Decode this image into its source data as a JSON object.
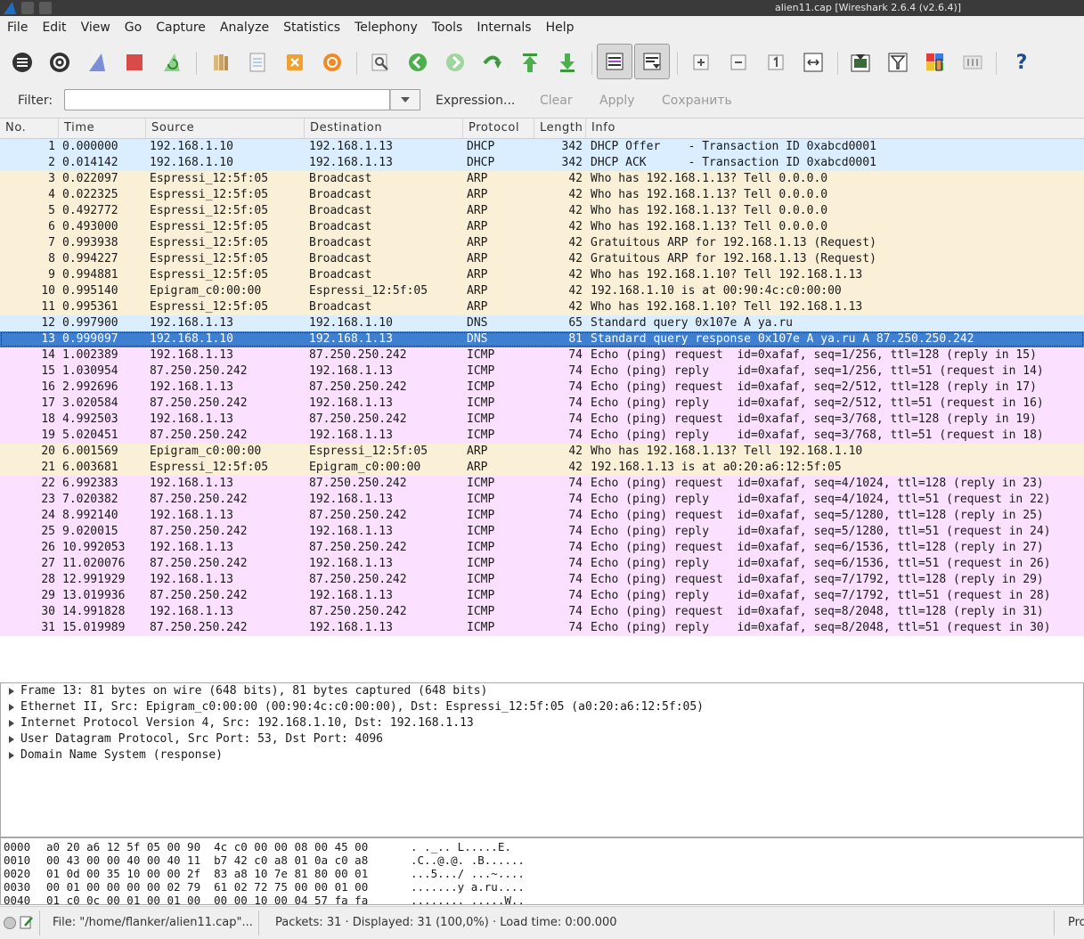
{
  "window": {
    "title": "alien11.cap [Wireshark 2.6.4 (v2.6.4)]"
  },
  "menu": [
    "File",
    "Edit",
    "View",
    "Go",
    "Capture",
    "Analyze",
    "Statistics",
    "Telephony",
    "Tools",
    "Internals",
    "Help"
  ],
  "filter": {
    "label": "Filter:",
    "value": "",
    "expression_label": "Expression...",
    "clear_label": "Clear",
    "apply_label": "Apply",
    "save_label": "Сохранить"
  },
  "packet_list": {
    "columns": [
      "No.",
      "Time",
      "Source",
      "Destination",
      "Protocol",
      "Length",
      "Info"
    ],
    "selected_no": "13",
    "rows": [
      {
        "no": "1",
        "time": "0.000000",
        "src": "192.168.1.10",
        "dst": "192.168.1.13",
        "proto": "DHCP",
        "len": "342",
        "info": "DHCP Offer    - Transaction ID 0xabcd0001",
        "cls": "dhcp"
      },
      {
        "no": "2",
        "time": "0.014142",
        "src": "192.168.1.10",
        "dst": "192.168.1.13",
        "proto": "DHCP",
        "len": "342",
        "info": "DHCP ACK      - Transaction ID 0xabcd0001",
        "cls": "dhcp"
      },
      {
        "no": "3",
        "time": "0.022097",
        "src": "Espressi_12:5f:05",
        "dst": "Broadcast",
        "proto": "ARP",
        "len": "42",
        "info": "Who has 192.168.1.13? Tell 0.0.0.0",
        "cls": "arp"
      },
      {
        "no": "4",
        "time": "0.022325",
        "src": "Espressi_12:5f:05",
        "dst": "Broadcast",
        "proto": "ARP",
        "len": "42",
        "info": "Who has 192.168.1.13? Tell 0.0.0.0",
        "cls": "arp"
      },
      {
        "no": "5",
        "time": "0.492772",
        "src": "Espressi_12:5f:05",
        "dst": "Broadcast",
        "proto": "ARP",
        "len": "42",
        "info": "Who has 192.168.1.13? Tell 0.0.0.0",
        "cls": "arp"
      },
      {
        "no": "6",
        "time": "0.493000",
        "src": "Espressi_12:5f:05",
        "dst": "Broadcast",
        "proto": "ARP",
        "len": "42",
        "info": "Who has 192.168.1.13? Tell 0.0.0.0",
        "cls": "arp"
      },
      {
        "no": "7",
        "time": "0.993938",
        "src": "Espressi_12:5f:05",
        "dst": "Broadcast",
        "proto": "ARP",
        "len": "42",
        "info": "Gratuitous ARP for 192.168.1.13 (Request)",
        "cls": "arp"
      },
      {
        "no": "8",
        "time": "0.994227",
        "src": "Espressi_12:5f:05",
        "dst": "Broadcast",
        "proto": "ARP",
        "len": "42",
        "info": "Gratuitous ARP for 192.168.1.13 (Request)",
        "cls": "arp"
      },
      {
        "no": "9",
        "time": "0.994881",
        "src": "Espressi_12:5f:05",
        "dst": "Broadcast",
        "proto": "ARP",
        "len": "42",
        "info": "Who has 192.168.1.10? Tell 192.168.1.13",
        "cls": "arp"
      },
      {
        "no": "10",
        "time": "0.995140",
        "src": "Epigram_c0:00:00",
        "dst": "Espressi_12:5f:05",
        "proto": "ARP",
        "len": "42",
        "info": "192.168.1.10 is at 00:90:4c:c0:00:00",
        "cls": "arp"
      },
      {
        "no": "11",
        "time": "0.995361",
        "src": "Espressi_12:5f:05",
        "dst": "Broadcast",
        "proto": "ARP",
        "len": "42",
        "info": "Who has 192.168.1.10? Tell 192.168.1.13",
        "cls": "arp"
      },
      {
        "no": "12",
        "time": "0.997900",
        "src": "192.168.1.13",
        "dst": "192.168.1.10",
        "proto": "DNS",
        "len": "65",
        "info": "Standard query 0x107e A ya.ru",
        "cls": "dns"
      },
      {
        "no": "13",
        "time": "0.999097",
        "src": "192.168.1.10",
        "dst": "192.168.1.13",
        "proto": "DNS",
        "len": "81",
        "info": "Standard query response 0x107e A ya.ru A 87.250.250.242",
        "cls": "sel"
      },
      {
        "no": "14",
        "time": "1.002389",
        "src": "192.168.1.13",
        "dst": "87.250.250.242",
        "proto": "ICMP",
        "len": "74",
        "info": "Echo (ping) request  id=0xafaf, seq=1/256, ttl=128 (reply in 15)",
        "cls": "icmp"
      },
      {
        "no": "15",
        "time": "1.030954",
        "src": "87.250.250.242",
        "dst": "192.168.1.13",
        "proto": "ICMP",
        "len": "74",
        "info": "Echo (ping) reply    id=0xafaf, seq=1/256, ttl=51 (request in 14)",
        "cls": "icmp"
      },
      {
        "no": "16",
        "time": "2.992696",
        "src": "192.168.1.13",
        "dst": "87.250.250.242",
        "proto": "ICMP",
        "len": "74",
        "info": "Echo (ping) request  id=0xafaf, seq=2/512, ttl=128 (reply in 17)",
        "cls": "icmp"
      },
      {
        "no": "17",
        "time": "3.020584",
        "src": "87.250.250.242",
        "dst": "192.168.1.13",
        "proto": "ICMP",
        "len": "74",
        "info": "Echo (ping) reply    id=0xafaf, seq=2/512, ttl=51 (request in 16)",
        "cls": "icmp"
      },
      {
        "no": "18",
        "time": "4.992503",
        "src": "192.168.1.13",
        "dst": "87.250.250.242",
        "proto": "ICMP",
        "len": "74",
        "info": "Echo (ping) request  id=0xafaf, seq=3/768, ttl=128 (reply in 19)",
        "cls": "icmp"
      },
      {
        "no": "19",
        "time": "5.020451",
        "src": "87.250.250.242",
        "dst": "192.168.1.13",
        "proto": "ICMP",
        "len": "74",
        "info": "Echo (ping) reply    id=0xafaf, seq=3/768, ttl=51 (request in 18)",
        "cls": "icmp"
      },
      {
        "no": "20",
        "time": "6.001569",
        "src": "Epigram_c0:00:00",
        "dst": "Espressi_12:5f:05",
        "proto": "ARP",
        "len": "42",
        "info": "Who has 192.168.1.13? Tell 192.168.1.10",
        "cls": "arp"
      },
      {
        "no": "21",
        "time": "6.003681",
        "src": "Espressi_12:5f:05",
        "dst": "Epigram_c0:00:00",
        "proto": "ARP",
        "len": "42",
        "info": "192.168.1.13 is at a0:20:a6:12:5f:05",
        "cls": "arp"
      },
      {
        "no": "22",
        "time": "6.992383",
        "src": "192.168.1.13",
        "dst": "87.250.250.242",
        "proto": "ICMP",
        "len": "74",
        "info": "Echo (ping) request  id=0xafaf, seq=4/1024, ttl=128 (reply in 23)",
        "cls": "icmp"
      },
      {
        "no": "23",
        "time": "7.020382",
        "src": "87.250.250.242",
        "dst": "192.168.1.13",
        "proto": "ICMP",
        "len": "74",
        "info": "Echo (ping) reply    id=0xafaf, seq=4/1024, ttl=51 (request in 22)",
        "cls": "icmp"
      },
      {
        "no": "24",
        "time": "8.992140",
        "src": "192.168.1.13",
        "dst": "87.250.250.242",
        "proto": "ICMP",
        "len": "74",
        "info": "Echo (ping) request  id=0xafaf, seq=5/1280, ttl=128 (reply in 25)",
        "cls": "icmp"
      },
      {
        "no": "25",
        "time": "9.020015",
        "src": "87.250.250.242",
        "dst": "192.168.1.13",
        "proto": "ICMP",
        "len": "74",
        "info": "Echo (ping) reply    id=0xafaf, seq=5/1280, ttl=51 (request in 24)",
        "cls": "icmp"
      },
      {
        "no": "26",
        "time": "10.992053",
        "src": "192.168.1.13",
        "dst": "87.250.250.242",
        "proto": "ICMP",
        "len": "74",
        "info": "Echo (ping) request  id=0xafaf, seq=6/1536, ttl=128 (reply in 27)",
        "cls": "icmp"
      },
      {
        "no": "27",
        "time": "11.020076",
        "src": "87.250.250.242",
        "dst": "192.168.1.13",
        "proto": "ICMP",
        "len": "74",
        "info": "Echo (ping) reply    id=0xafaf, seq=6/1536, ttl=51 (request in 26)",
        "cls": "icmp"
      },
      {
        "no": "28",
        "time": "12.991929",
        "src": "192.168.1.13",
        "dst": "87.250.250.242",
        "proto": "ICMP",
        "len": "74",
        "info": "Echo (ping) request  id=0xafaf, seq=7/1792, ttl=128 (reply in 29)",
        "cls": "icmp"
      },
      {
        "no": "29",
        "time": "13.019936",
        "src": "87.250.250.242",
        "dst": "192.168.1.13",
        "proto": "ICMP",
        "len": "74",
        "info": "Echo (ping) reply    id=0xafaf, seq=7/1792, ttl=51 (request in 28)",
        "cls": "icmp"
      },
      {
        "no": "30",
        "time": "14.991828",
        "src": "192.168.1.13",
        "dst": "87.250.250.242",
        "proto": "ICMP",
        "len": "74",
        "info": "Echo (ping) request  id=0xafaf, seq=8/2048, ttl=128 (reply in 31)",
        "cls": "icmp"
      },
      {
        "no": "31",
        "time": "15.019989",
        "src": "87.250.250.242",
        "dst": "192.168.1.13",
        "proto": "ICMP",
        "len": "74",
        "info": "Echo (ping) reply    id=0xafaf, seq=8/2048, ttl=51 (request in 30)",
        "cls": "icmp"
      }
    ]
  },
  "details": [
    "Frame 13: 81 bytes on wire (648 bits), 81 bytes captured (648 bits)",
    "Ethernet II, Src: Epigram_c0:00:00 (00:90:4c:c0:00:00), Dst: Espressi_12:5f:05 (a0:20:a6:12:5f:05)",
    "Internet Protocol Version 4, Src: 192.168.1.10, Dst: 192.168.1.13",
    "User Datagram Protocol, Src Port: 53, Dst Port: 4096",
    "Domain Name System (response)"
  ],
  "hex": [
    {
      "off": "0000",
      "bytes": "a0 20 a6 12 5f 05 00 90  4c c0 00 00 08 00 45 00",
      "ascii": ". ._.. L.....E."
    },
    {
      "off": "0010",
      "bytes": "00 43 00 00 40 00 40 11  b7 42 c0 a8 01 0a c0 a8",
      "ascii": ".C..@.@. .B......"
    },
    {
      "off": "0020",
      "bytes": "01 0d 00 35 10 00 00 2f  83 a8 10 7e 81 80 00 01",
      "ascii": "...5.../ ...~...."
    },
    {
      "off": "0030",
      "bytes": "00 01 00 00 00 00 02 79  61 02 72 75 00 00 01 00",
      "ascii": ".......y a.ru...."
    },
    {
      "off": "0040",
      "bytes": "01 c0 0c 00 01 00 01 00  00 00 10 00 04 57 fa fa",
      "ascii": "........ .....W.."
    }
  ],
  "status": {
    "file": "File: \"/home/flanker/alien11.cap\"...",
    "packets": "Packets: 31 · Displayed: 31 (100,0%) · Load time: 0:00.000",
    "profile": "Pro"
  },
  "colors": {
    "dhcp_dns": "#daeeff",
    "arp": "#faf0d7",
    "icmp": "#fce0ff",
    "selected": "#3f7fd0"
  }
}
